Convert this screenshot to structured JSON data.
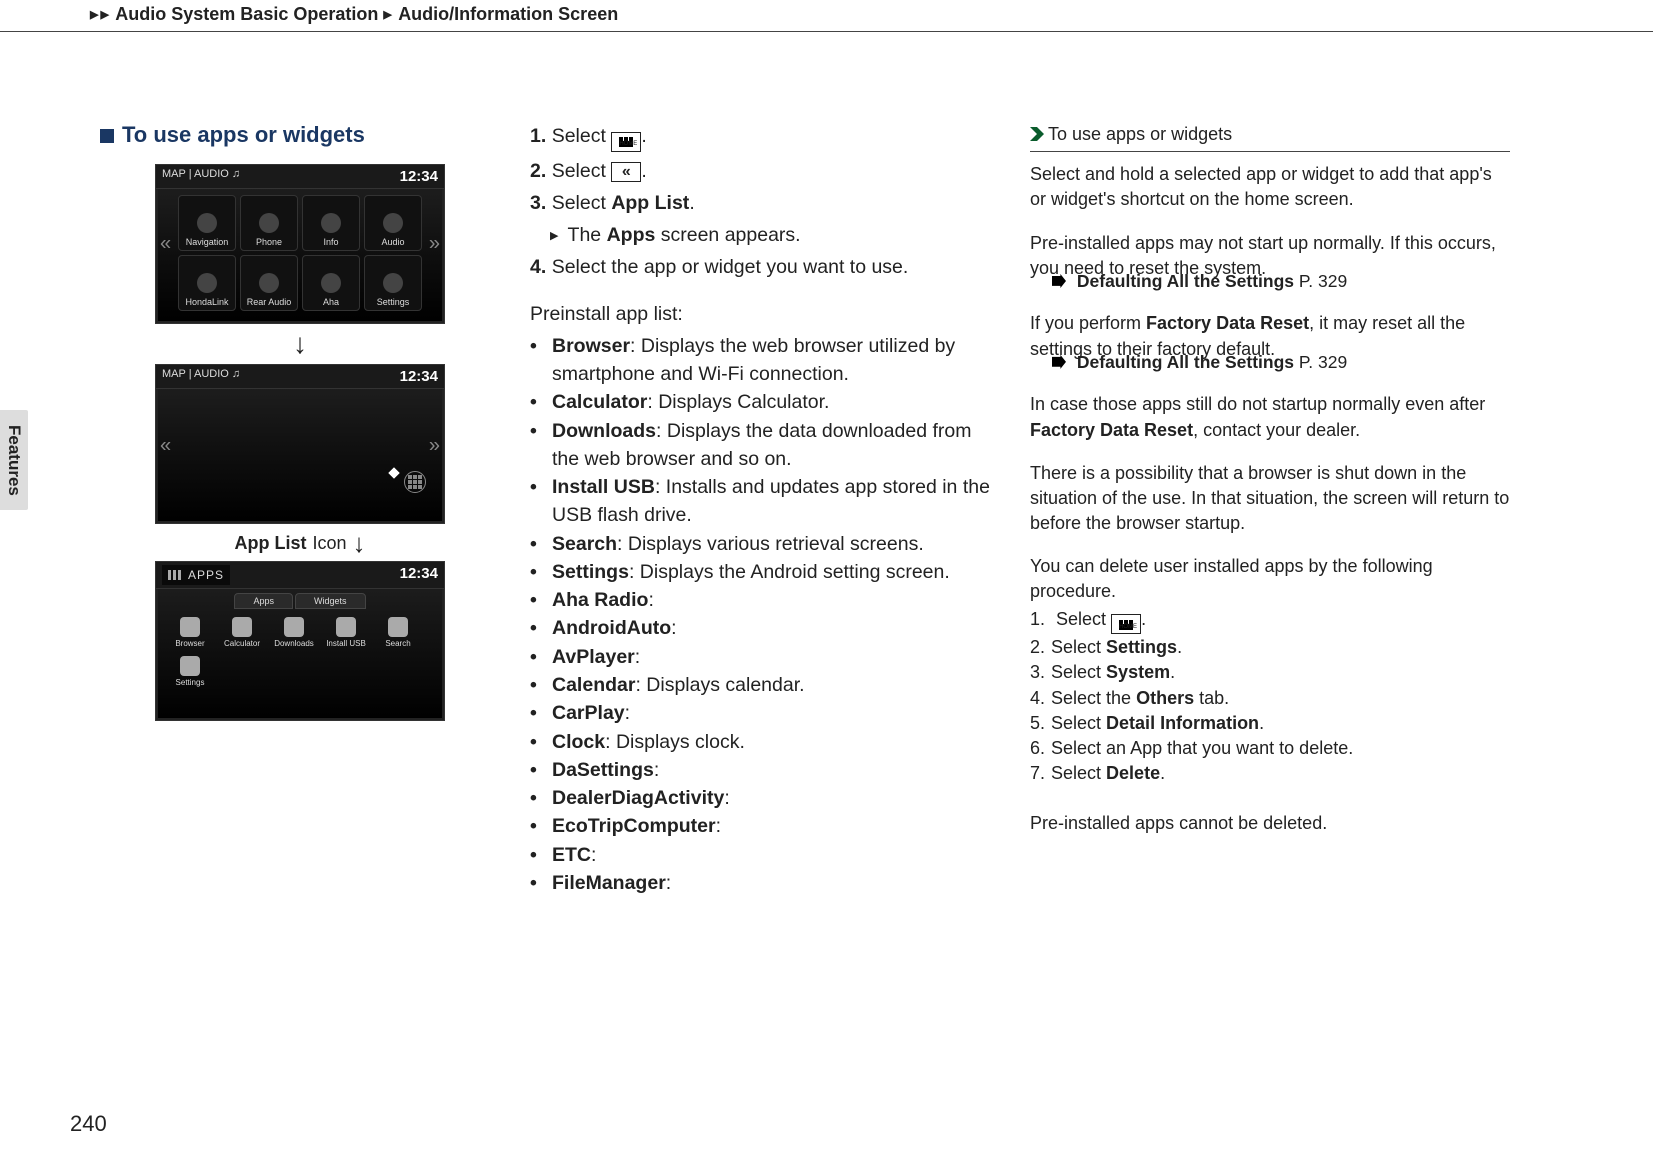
{
  "header": {
    "breadcrumb_1": "Audio System Basic Operation",
    "breadcrumb_2": "Audio/Information Screen"
  },
  "side_tab": "Features",
  "page_number": "240",
  "section_title": "To use apps or widgets",
  "screenshots": {
    "clock": "12:34",
    "top_tabs": {
      "map": "MAP",
      "audio": "AUDIO"
    },
    "sc1_cells": [
      "Navigation",
      "Phone",
      "Info",
      "Audio",
      "HondaLink",
      "Rear Audio",
      "Aha",
      "Settings"
    ],
    "sc3_title": "APPS",
    "sc3_tabs": [
      "Apps",
      "Widgets"
    ],
    "sc3_row": [
      "Browser",
      "Calculator",
      "Downloads",
      "Install USB",
      "Search"
    ],
    "sc3_row2": [
      "Settings"
    ],
    "app_list_label": "App List",
    "app_list_label_suffix": "Icon"
  },
  "steps": {
    "s1": {
      "num": "1.",
      "text": "Select "
    },
    "s2": {
      "num": "2.",
      "text": "Select "
    },
    "s3": {
      "num": "3.",
      "pre": "Select ",
      "bold": "App List"
    },
    "s3_sub_pre": "The ",
    "s3_sub_bold": "Apps",
    "s3_sub_post": " screen appears.",
    "s4": {
      "num": "4.",
      "text": "Select the app or widget you want to use."
    }
  },
  "preinstall_intro": "Preinstall app list:",
  "apps": [
    {
      "name": "Browser",
      "desc": "Displays the web browser utilized by smartphone and Wi-Fi connection."
    },
    {
      "name": "Calculator",
      "desc": "Displays Calculator."
    },
    {
      "name": "Downloads",
      "desc": "Displays the data downloaded from the web browser and so on."
    },
    {
      "name": "Install USB",
      "desc": "Installs and updates app stored in the USB flash drive."
    },
    {
      "name": "Search",
      "desc": "Displays various retrieval screens."
    },
    {
      "name": "Settings",
      "desc": "Displays the Android setting screen."
    },
    {
      "name": "Aha Radio",
      "desc": ""
    },
    {
      "name": "AndroidAuto",
      "desc": ""
    },
    {
      "name": "AvPlayer",
      "desc": ""
    },
    {
      "name": "Calendar",
      "desc": "Displays calendar."
    },
    {
      "name": "CarPlay",
      "desc": ""
    },
    {
      "name": "Clock",
      "desc": "Displays clock."
    },
    {
      "name": "DaSettings",
      "desc": ""
    },
    {
      "name": "DealerDiagActivity",
      "desc": ""
    },
    {
      "name": "EcoTripComputer",
      "desc": ""
    },
    {
      "name": "ETC",
      "desc": ""
    },
    {
      "name": "FileManager",
      "desc": ""
    }
  ],
  "tips": {
    "title": "To use apps or widgets",
    "p1": "Select and hold a selected app or widget to add that app's or widget's shortcut on the home screen.",
    "p2": "Pre-installed apps may not start up normally. If this occurs, you need to reset the system.",
    "ref1_label": "Defaulting All the Settings",
    "ref1_page": "P. 329",
    "p3_pre": "If you perform ",
    "p3_bold": "Factory Data Reset",
    "p3_post": ", it may reset all the settings to their factory default.",
    "ref2_label": "Defaulting All the Settings",
    "ref2_page": "P. 329",
    "p4_pre": "In case those apps still do not startup normally even after ",
    "p4_bold": "Factory Data Reset",
    "p4_post": ", contact your dealer.",
    "p5": "There is a possibility that a browser is shut down in the situation of the use. In that situation, the screen will return to before the browser startup.",
    "p6": "You can delete user installed apps by the following procedure.",
    "proc": {
      "s1_pre": "Select ",
      "s1_post": ".",
      "s2": "Settings",
      "s2_pre": "Select ",
      "s2_post": ".",
      "s3": "System",
      "s3_pre": "Select ",
      "s3_post": ".",
      "s4": "Others",
      "s4_pre": "Select the ",
      "s4_post": " tab.",
      "s5": "Detail Information",
      "s5_pre": "Select ",
      "s5_post": ".",
      "s6": "Select an App that you want to delete.",
      "s7": "Delete",
      "s7_pre": "Select ",
      "s7_post": "."
    },
    "p7": "Pre-installed apps cannot be deleted."
  }
}
